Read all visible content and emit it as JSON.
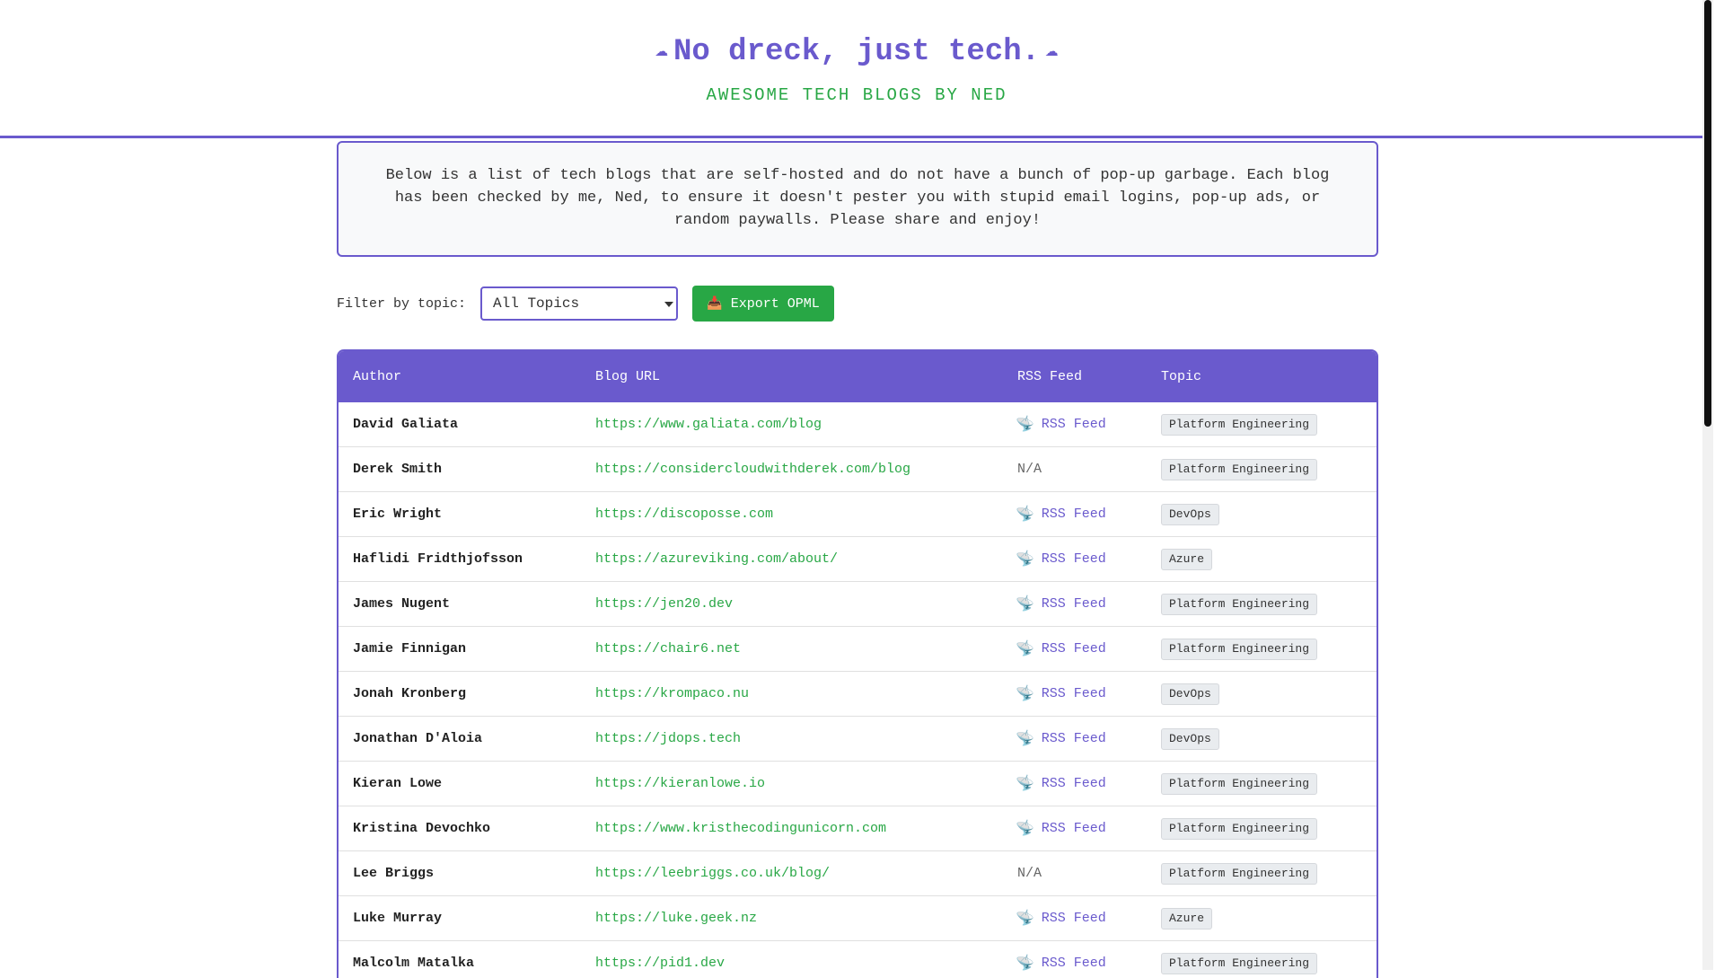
{
  "header": {
    "title": "No dreck, just tech.",
    "cloud_glyph": "☁",
    "subtitle": "AWESOME TECH BLOGS BY NED"
  },
  "intro": {
    "text": "Below is a list of tech blogs that are self-hosted and do not have a bunch of pop-up garbage. Each blog has been checked by me, Ned, to ensure it doesn't pester you with stupid email logins, pop-up ads, or random paywalls. Please share and enjoy!"
  },
  "controls": {
    "filter_label": "Filter by topic:",
    "filter_selected": "All Topics",
    "export_icon": "📥",
    "export_label": "Export OPML"
  },
  "table": {
    "headers": [
      "Author",
      "Blog URL",
      "RSS Feed",
      "Topic"
    ],
    "rss_icon": "📡",
    "rows": [
      {
        "author": "David Galiata",
        "url": "https://www.galiata.com/blog",
        "rss": "RSS Feed",
        "topic": "Platform Engineering"
      },
      {
        "author": "Derek Smith",
        "url": "https://considercloudwithderek.com/blog",
        "rss": "N/A",
        "topic": "Platform Engineering"
      },
      {
        "author": "Eric Wright",
        "url": "https://discoposse.com",
        "rss": "RSS Feed",
        "topic": "DevOps"
      },
      {
        "author": "Haflidi Fridthjofsson",
        "url": "https://azureviking.com/about/",
        "rss": "RSS Feed",
        "topic": "Azure"
      },
      {
        "author": "James Nugent",
        "url": "https://jen20.dev",
        "rss": "RSS Feed",
        "topic": "Platform Engineering"
      },
      {
        "author": "Jamie Finnigan",
        "url": "https://chair6.net",
        "rss": "RSS Feed",
        "topic": "Platform Engineering"
      },
      {
        "author": "Jonah Kronberg",
        "url": "https://krompaco.nu",
        "rss": "RSS Feed",
        "topic": "DevOps"
      },
      {
        "author": "Jonathan D'Aloia",
        "url": "https://jdops.tech",
        "rss": "RSS Feed",
        "topic": "DevOps"
      },
      {
        "author": "Kieran Lowe",
        "url": "https://kieranlowe.io",
        "rss": "RSS Feed",
        "topic": "Platform Engineering"
      },
      {
        "author": "Kristina Devochko",
        "url": "https://www.kristhecodingunicorn.com",
        "rss": "RSS Feed",
        "topic": "Platform Engineering"
      },
      {
        "author": "Lee Briggs",
        "url": "https://leebriggs.co.uk/blog/",
        "rss": "N/A",
        "topic": "Platform Engineering"
      },
      {
        "author": "Luke Murray",
        "url": "https://luke.geek.nz",
        "rss": "RSS Feed",
        "topic": "Azure"
      },
      {
        "author": "Malcolm Matalka",
        "url": "https://pid1.dev",
        "rss": "RSS Feed",
        "topic": "Platform Engineering"
      }
    ]
  },
  "colors": {
    "accent": "#6a5acd",
    "link_green": "#28a745",
    "tag_bg": "#e9ecef"
  }
}
